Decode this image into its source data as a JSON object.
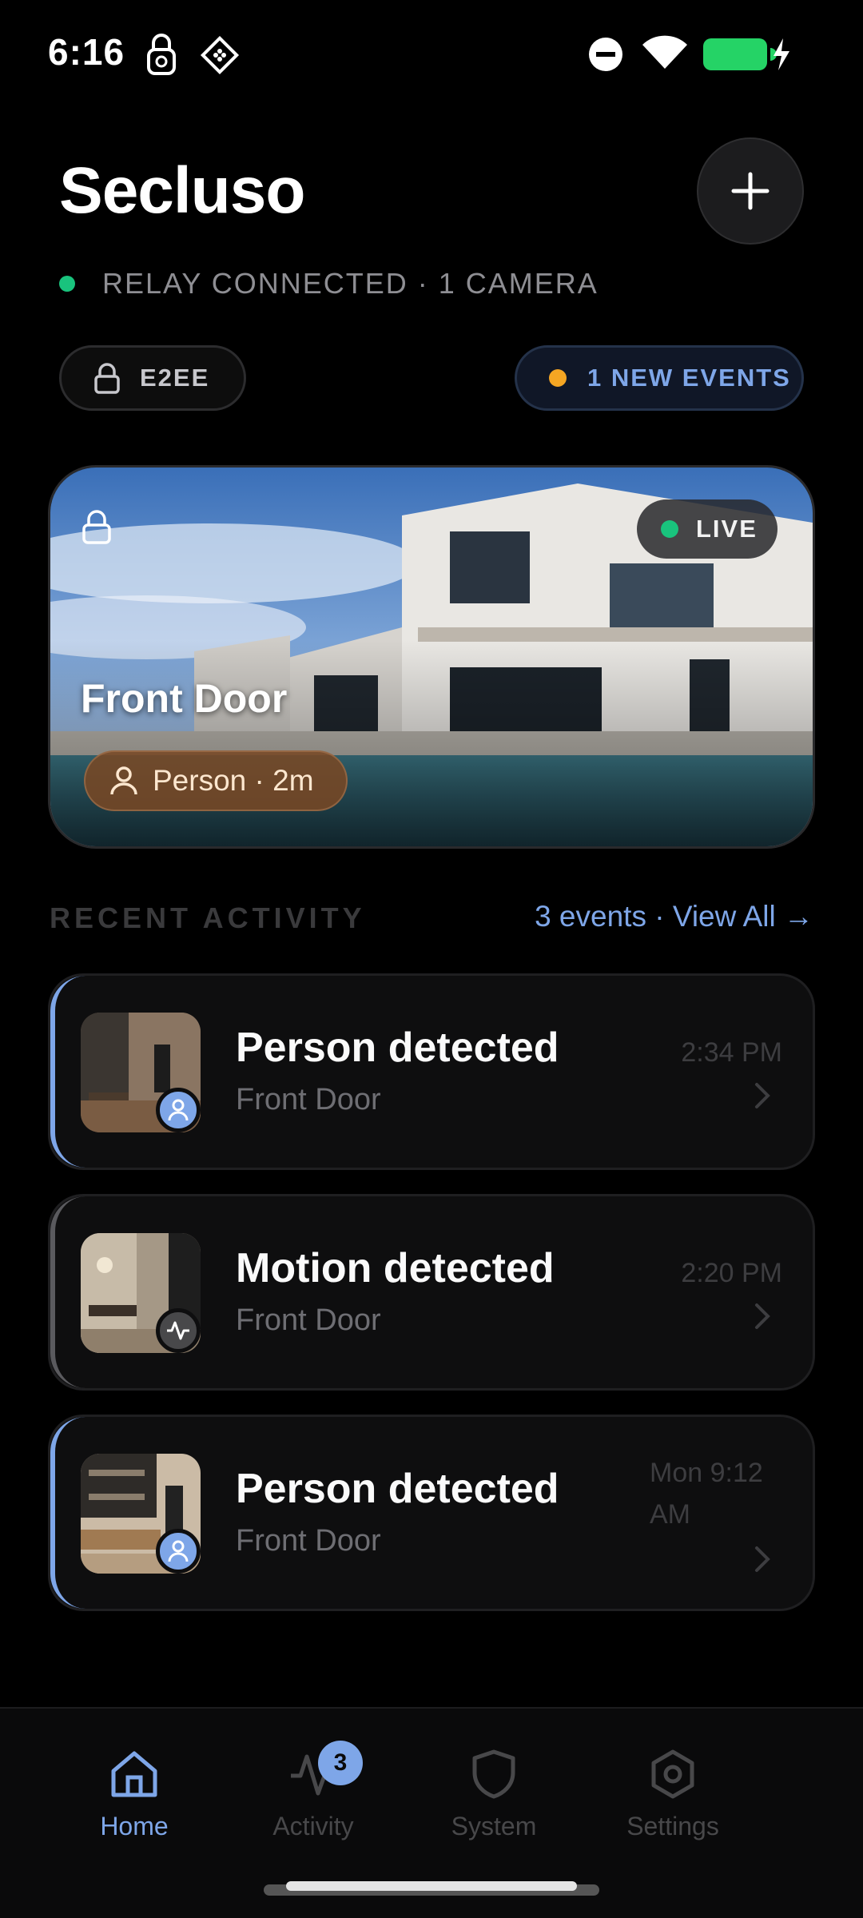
{
  "status_bar": {
    "time": "6:16"
  },
  "header": {
    "title": "Secluso",
    "relay_status": "RELAY CONNECTED · 1 CAMERA",
    "e2ee_label": "E2EE",
    "events_label": "1 NEW EVENTS"
  },
  "camera": {
    "name": "Front Door",
    "live_label": "LIVE",
    "detection_tag": "Person · 2m"
  },
  "recent": {
    "title": "RECENT ACTIVITY",
    "view_all": "3 events · View All →",
    "events": [
      {
        "title": "Person detected",
        "location": "Front Door",
        "time": "2:34 PM",
        "type": "person",
        "icon": "person-icon"
      },
      {
        "title": "Motion detected",
        "location": "Front Door",
        "time": "2:20 PM",
        "type": "motion",
        "icon": "activity-icon"
      },
      {
        "title": "Person detected",
        "location": "Front Door",
        "time": "Mon 9:12 AM",
        "type": "person",
        "icon": "person-icon"
      }
    ]
  },
  "nav": {
    "items": [
      {
        "label": "Home",
        "icon": "home-icon",
        "active": true
      },
      {
        "label": "Activity",
        "icon": "activity-icon",
        "badge": "3"
      },
      {
        "label": "System",
        "icon": "shield-icon"
      },
      {
        "label": "Settings",
        "icon": "gear-icon"
      }
    ]
  },
  "colors": {
    "accent": "#7ea6e8",
    "online": "#19c37d",
    "warning": "#f5a623",
    "background": "#000000"
  }
}
